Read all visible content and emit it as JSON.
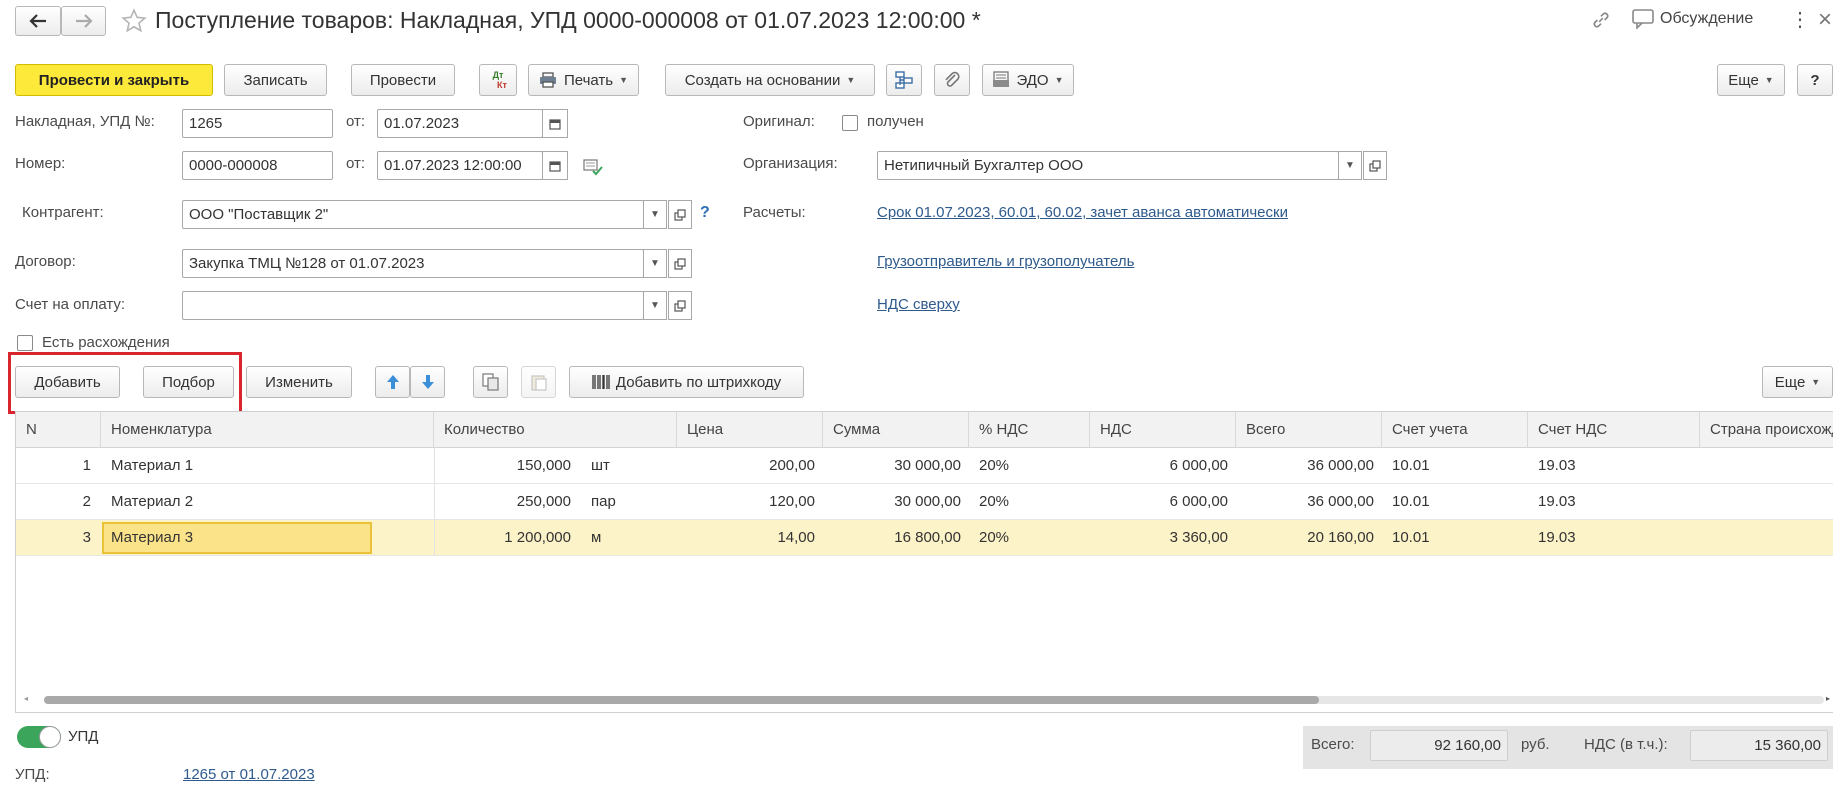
{
  "window": {
    "title": "Поступление товаров: Накладная, УПД 0000-000008 от 01.07.2023 12:00:00 *",
    "discussion_label": "Обсуждение"
  },
  "toolbar": {
    "post_close": "Провести и закрыть",
    "save": "Записать",
    "post": "Провести",
    "dtkt_top": "Дт",
    "dtkt_bottom": "Кт",
    "print": "Печать",
    "create_based": "Создать на основании",
    "edo": "ЭДО",
    "more": "Еще",
    "help": "?"
  },
  "form": {
    "invoice_label": "Накладная, УПД №:",
    "invoice_value": "1265",
    "from_label": "от:",
    "invoice_date": "01.07.2023",
    "number_label": "Номер:",
    "number_value": "0000-000008",
    "number_date": "01.07.2023 12:00:00",
    "original_label": "Оригинал:",
    "original_received": "получен",
    "org_label": "Организация:",
    "org_value": "Нетипичный Бухгалтер ООО",
    "counterparty_label": "Контрагент:",
    "counterparty_value": "ООО \"Поставщик 2\"",
    "question": "?",
    "settlements_label": "Расчеты:",
    "settlements_link": "Срок 01.07.2023, 60.01, 60.02, зачет аванса автоматически",
    "contract_label": "Договор:",
    "contract_value": "Закупка ТМЦ №128 от 01.07.2023",
    "shipper_link": "Грузоотправитель и грузополучатель",
    "payment_invoice_label": "Счет на оплату:",
    "payment_invoice_value": "",
    "vat_link": "НДС сверху",
    "discrepancy_label": "Есть расхождения"
  },
  "table_toolbar": {
    "add": "Добавить",
    "pick": "Подбор",
    "change": "Изменить",
    "add_barcode": "Добавить по штрихкоду",
    "more": "Еще"
  },
  "table": {
    "columns": [
      "N",
      "Номенклатура",
      "Количество",
      "Цена",
      "Сумма",
      "% НДС",
      "НДС",
      "Всего",
      "Счет учета",
      "Счет НДС",
      "Страна происхождения"
    ],
    "rows": [
      {
        "n": "1",
        "name": "Материал 1",
        "qty": "150,000",
        "unit": "шт",
        "price": "200,00",
        "sum": "30 000,00",
        "vat_rate": "20%",
        "vat": "6 000,00",
        "total": "36 000,00",
        "account": "10.01",
        "vat_account": "19.03"
      },
      {
        "n": "2",
        "name": "Материал 2",
        "qty": "250,000",
        "unit": "пар",
        "price": "120,00",
        "sum": "30 000,00",
        "vat_rate": "20%",
        "vat": "6 000,00",
        "total": "36 000,00",
        "account": "10.01",
        "vat_account": "19.03"
      },
      {
        "n": "3",
        "name": "Материал 3",
        "qty": "1 200,000",
        "unit": "м",
        "price": "14,00",
        "sum": "16 800,00",
        "vat_rate": "20%",
        "vat": "3 360,00",
        "total": "20 160,00",
        "account": "10.01",
        "vat_account": "19.03"
      }
    ],
    "selected_row": 2
  },
  "footer": {
    "upd_toggle_label": "УПД",
    "upd_on": true,
    "upd_label": "УПД:",
    "upd_link": "1265 от 01.07.2023",
    "total_label": "Всего:",
    "total_value": "92 160,00",
    "currency": "руб.",
    "vat_label": "НДС (в т.ч.):",
    "vat_value": "15 360,00"
  },
  "colors": {
    "primary_button": "#fde93a",
    "link": "#2e5a8c",
    "highlight_box": "#d9262e",
    "selected_row": "#fdf3c8",
    "toggle_on": "#3ba55c",
    "arrow_blue": "#3b8ed8"
  }
}
